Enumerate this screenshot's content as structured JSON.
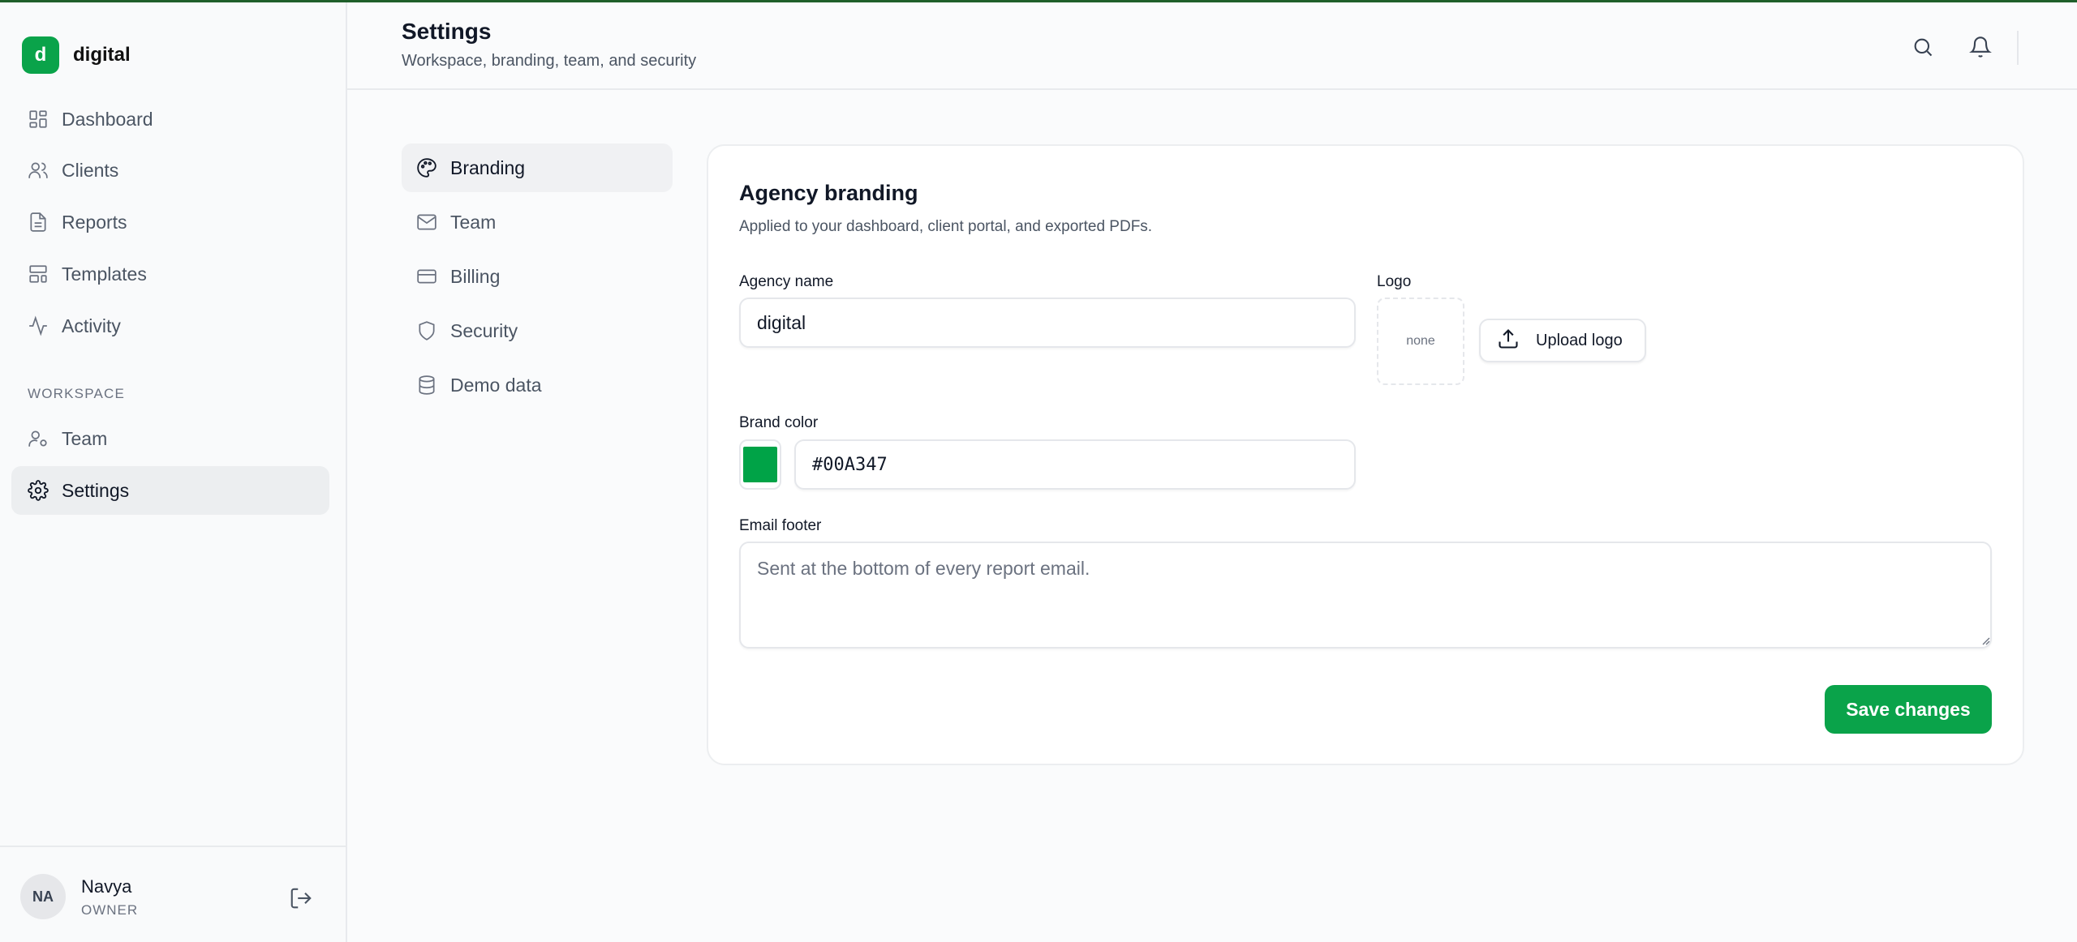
{
  "app": {
    "logo_letter": "d",
    "name": "digital",
    "brand_color": "#0aa34a"
  },
  "sidebar": {
    "items": [
      {
        "label": "Dashboard",
        "icon": "dashboard-icon"
      },
      {
        "label": "Clients",
        "icon": "users-icon"
      },
      {
        "label": "Reports",
        "icon": "file-icon"
      },
      {
        "label": "Templates",
        "icon": "layout-icon"
      },
      {
        "label": "Activity",
        "icon": "activity-icon"
      }
    ],
    "section_label": "WORKSPACE",
    "workspace_items": [
      {
        "label": "Team",
        "icon": "user-cog-icon"
      },
      {
        "label": "Settings",
        "icon": "gear-icon",
        "active": true
      }
    ],
    "user": {
      "initials": "NA",
      "name": "Navya",
      "role": "OWNER"
    }
  },
  "header": {
    "title": "Settings",
    "subtitle": "Workspace, branding, team, and security"
  },
  "settings_nav": [
    {
      "label": "Branding",
      "icon": "palette-icon",
      "active": true
    },
    {
      "label": "Team",
      "icon": "mail-icon"
    },
    {
      "label": "Billing",
      "icon": "credit-card-icon"
    },
    {
      "label": "Security",
      "icon": "shield-icon"
    },
    {
      "label": "Demo data",
      "icon": "database-icon"
    }
  ],
  "branding": {
    "title": "Agency branding",
    "description": "Applied to your dashboard, client portal, and exported PDFs.",
    "agency_name_label": "Agency name",
    "agency_name_value": "digital",
    "logo_label": "Logo",
    "logo_placeholder": "none",
    "upload_label": "Upload logo",
    "brand_color_label": "Brand color",
    "brand_color_value": "#00A347",
    "email_footer_label": "Email footer",
    "email_footer_value": "",
    "email_footer_placeholder": "Sent at the bottom of every report email.",
    "save_label": "Save changes"
  }
}
